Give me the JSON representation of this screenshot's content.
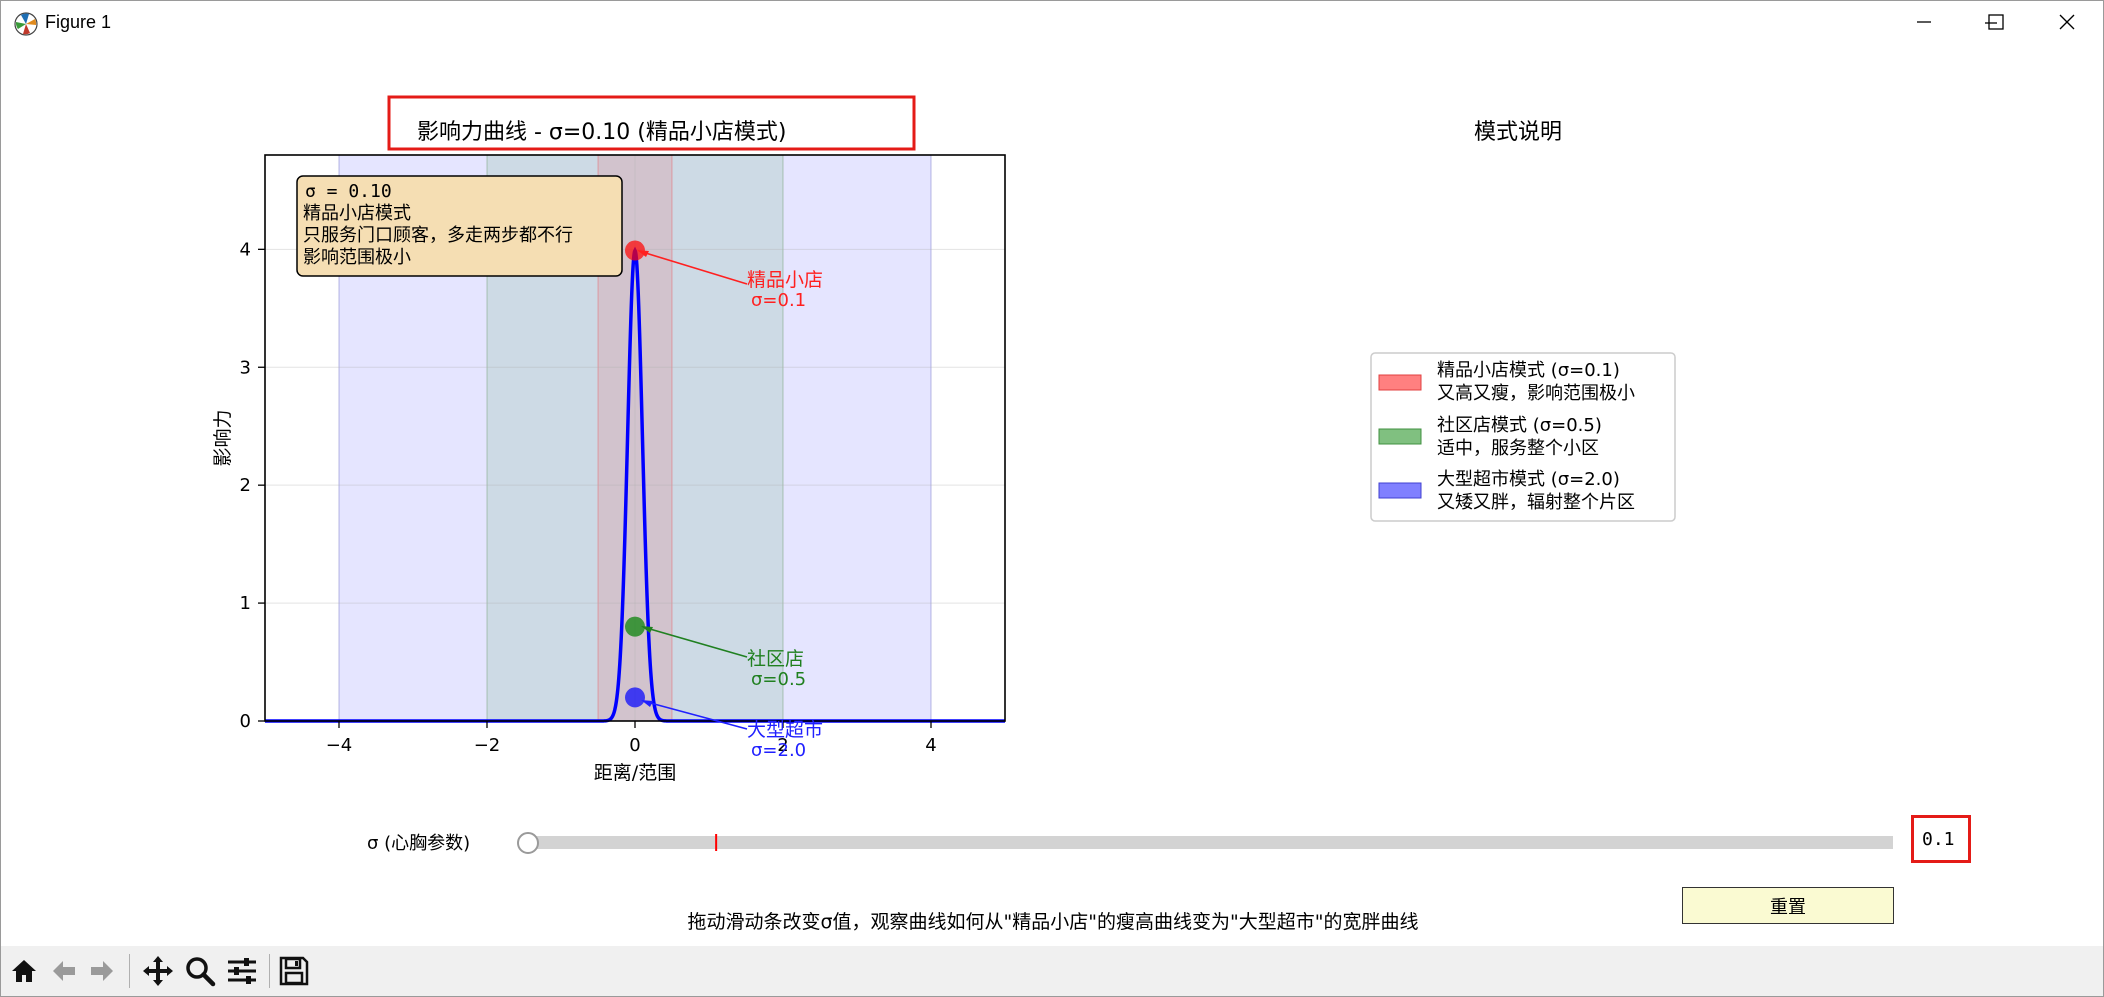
{
  "window": {
    "title": "Figure 1"
  },
  "plot": {
    "title": "影响力曲线 - σ=0.10 (精品小店模式)",
    "xlabel": "距离/范围",
    "ylabel": "影响力",
    "info_box": {
      "line1": "σ = 0.10",
      "line2": "精品小店模式",
      "line3": "只服务门口顾客，多走两步都不行",
      "line4": "影响范围极小"
    },
    "annotations": {
      "boutique_name": "精品小店",
      "boutique_sigma": "σ=0.1",
      "community_name": "社区店",
      "community_sigma": "σ=0.5",
      "super_name": "大型超市",
      "super_sigma": "σ=2.0"
    }
  },
  "chart_data": {
    "type": "line",
    "title": "影响力曲线 - σ=0.10 (精品小店模式)",
    "xlabel": "距离/范围",
    "ylabel": "影响力",
    "xlim": [
      -5,
      5
    ],
    "ylim": [
      0,
      4.8
    ],
    "xticks": [
      -4,
      -2,
      0,
      2,
      4
    ],
    "yticks": [
      0,
      1,
      2,
      3,
      4
    ],
    "grid": true,
    "sigma": 0.1,
    "curve": "gaussian",
    "series": [
      {
        "sigma": 0.1,
        "color": "#0000ff"
      }
    ],
    "shaded_ranges": [
      {
        "x": [
          -0.5,
          0.5
        ],
        "color": "#ff0000"
      },
      {
        "x": [
          -2,
          2
        ],
        "color": "#008000"
      },
      {
        "x": [
          -4,
          4
        ],
        "color": "#0000ff"
      }
    ],
    "markers": [
      {
        "x": 0,
        "y": 3.99,
        "color": "#ff0000"
      },
      {
        "x": 0,
        "y": 0.8,
        "color": "#008000"
      },
      {
        "x": 0,
        "y": 0.2,
        "color": "#0000ff"
      }
    ]
  },
  "legend_panel": {
    "title": "模式说明",
    "items": [
      {
        "line1": "精品小店模式 (σ=0.1)",
        "line2": "又高又瘦，影响范围极小",
        "color": "#ff8080",
        "edge": "#e04040"
      },
      {
        "line1": "社区店模式 (σ=0.5)",
        "line2": "适中，服务整个小区",
        "color": "#80c080",
        "edge": "#409040"
      },
      {
        "line1": "大型超市模式 (σ=2.0)",
        "line2": "又矮又胖，辐射整个片区",
        "color": "#8080ff",
        "edge": "#4040d0"
      }
    ]
  },
  "controls": {
    "slider_label": "σ (心胸参数)",
    "slider_value": "0.1",
    "slider_min": 0.1,
    "slider_max": 3.0,
    "slider_marker": 0.5,
    "reset_label": "重置",
    "hint": "拖动滑动条改变σ值，观察曲线如何从\"精品小店\"的瘦高曲线变为\"大型超市\"的宽胖曲线"
  },
  "toolbar": {
    "icons": [
      "home-icon",
      "back-arrow-icon",
      "forward-arrow-icon",
      "pan-move-icon",
      "zoom-magnifier-icon",
      "configure-sliders-icon",
      "save-floppy-icon"
    ]
  }
}
